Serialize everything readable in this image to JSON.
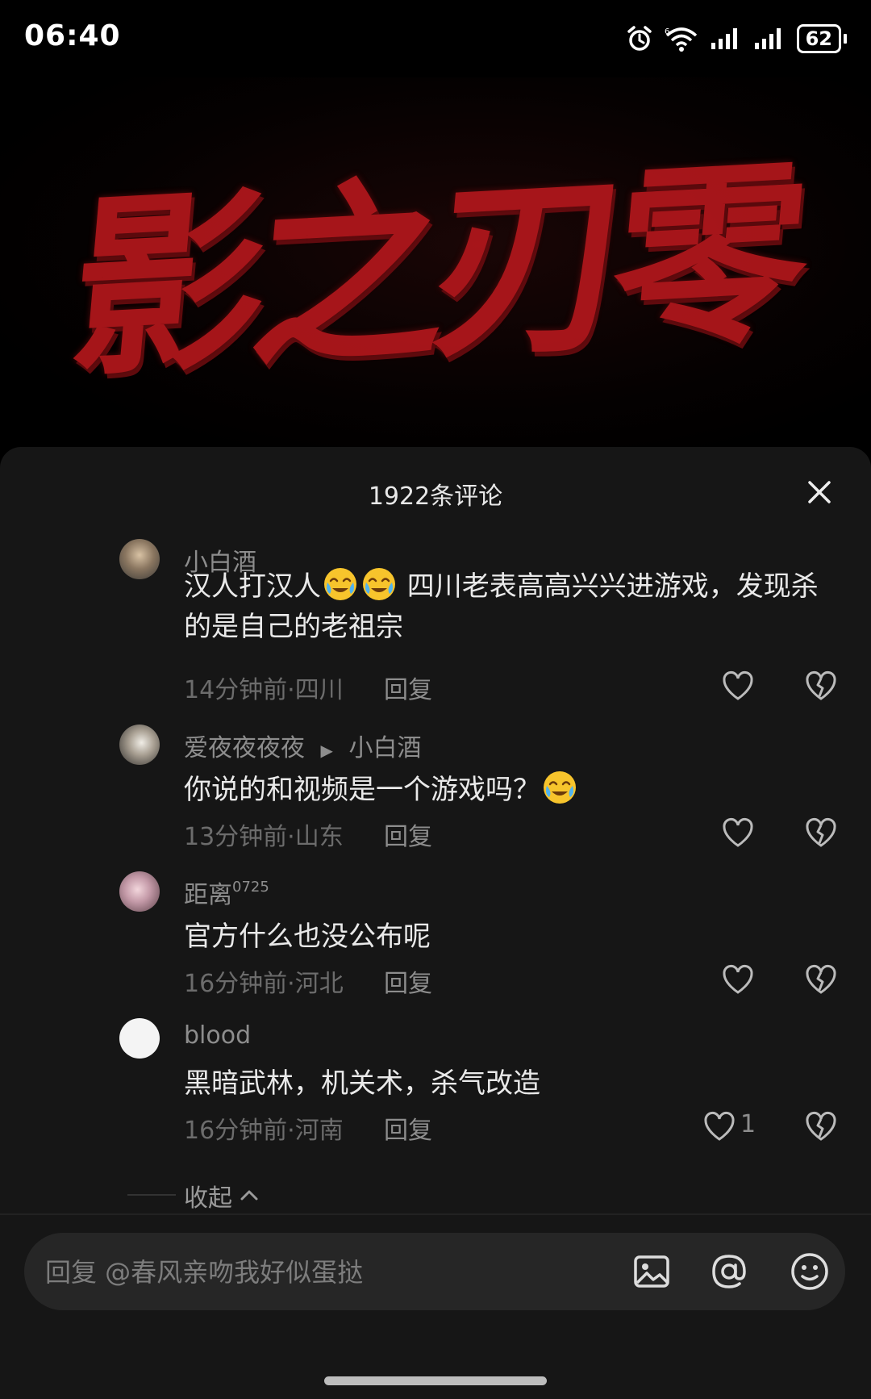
{
  "status_bar": {
    "time": "06:40",
    "battery": "62"
  },
  "video": {
    "title_art": "影之刃零"
  },
  "comments_sheet": {
    "title": "1922条评论",
    "comments": [
      {
        "username": "小白酒",
        "text_before": "汉人打汉人",
        "text_after": " 四川老表高高兴兴进游戏，发现杀的是自己的老祖宗",
        "meta": "14分钟前·四川",
        "reply_label": "回复"
      },
      {
        "username": "爱夜夜夜夜",
        "reply_to": "小白酒",
        "text": "你说的和视频是一个游戏吗？",
        "meta": "13分钟前·山东",
        "reply_label": "回复"
      },
      {
        "username": "距离",
        "username_sup": "0725",
        "text": "官方什么也没公布呢",
        "meta": "16分钟前·河北",
        "reply_label": "回复"
      },
      {
        "username": "blood",
        "text": "黑暗武林，机关术，杀气改造",
        "meta": "16分钟前·河南",
        "reply_label": "回复",
        "likes": "1"
      }
    ],
    "collapse_label": "收起"
  },
  "input": {
    "placeholder": "回复 @春风亲吻我好似蛋挞"
  },
  "icons": [
    "alarm-icon",
    "wifi-icon",
    "signal-icon",
    "close-icon",
    "heart-icon",
    "broken-heart-icon",
    "image-icon",
    "at-icon",
    "emoji-icon",
    "cry-laugh-emoji"
  ],
  "colors": {
    "sheet_bg": "#161616",
    "accent_red": "#b3171c",
    "muted_text": "#8d8d8d"
  }
}
